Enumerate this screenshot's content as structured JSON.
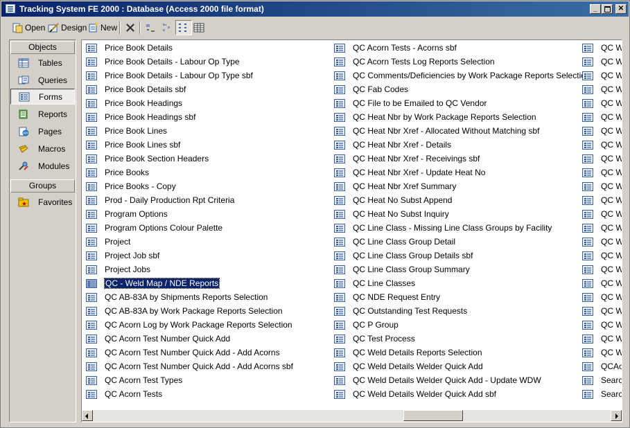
{
  "window": {
    "title": "Tracking System FE 2000 : Database (Access 2000 file format)"
  },
  "toolbar": {
    "open_label": "Open",
    "design_label": "Design",
    "new_label": "New"
  },
  "sidebar": {
    "objects_header": "Objects",
    "groups_header": "Groups",
    "items": [
      {
        "label": "Tables",
        "icon": "table-icon"
      },
      {
        "label": "Queries",
        "icon": "query-icon"
      },
      {
        "label": "Forms",
        "icon": "form-icon",
        "selected": true
      },
      {
        "label": "Reports",
        "icon": "report-icon"
      },
      {
        "label": "Pages",
        "icon": "page-icon"
      },
      {
        "label": "Macros",
        "icon": "macro-icon"
      },
      {
        "label": "Modules",
        "icon": "module-icon"
      }
    ],
    "groups": [
      {
        "label": "Favorites",
        "icon": "favorites-icon"
      }
    ]
  },
  "forms": {
    "columns": [
      [
        "Price Book Details",
        "Price Book Details - Labour Op Type",
        "Price Book Details - Labour Op Type sbf",
        "Price Book Details sbf",
        "Price Book Headings",
        "Price Book Headings sbf",
        "Price Book Lines",
        "Price Book Lines sbf",
        "Price Book Section Headers",
        "Price Books",
        "Price Books - Copy",
        "Prod -  Daily Production Rpt Criteria",
        "Program Options",
        "Program Options Colour Palette",
        "Project",
        "Project Job sbf",
        "Project Jobs",
        "QC - Weld Map / NDE Reports",
        "QC AB-83A by Shipments Reports Selection",
        "QC AB-83A by Work Package Reports Selection",
        "QC Acorn Log by Work Package Reports Selection",
        "QC Acorn Test Number Quick Add",
        "QC Acorn Test Number Quick Add - Add Acorns",
        "QC Acorn Test Number Quick Add - Add Acorns sbf",
        "QC Acorn Test Types",
        "QC Acorn Tests"
      ],
      [
        "QC Acorn Tests - Acorns sbf",
        "QC Acorn Tests Log Reports Selection",
        "QC Comments/Deficiencies by Work Package Reports Selection",
        "QC Fab Codes",
        "QC File to be Emailed to QC Vendor",
        "QC Heat Nbr by Work Package Reports Selection",
        "QC Heat Nbr Xref - Allocated Without Matching sbf",
        "QC Heat Nbr Xref - Details",
        "QC Heat Nbr Xref - Receivings sbf",
        "QC Heat Nbr Xref - Update Heat No",
        "QC Heat Nbr Xref Summary",
        "QC Heat No Subst Append",
        "QC Heat No Subst Inquiry",
        "QC Line Class - Missing Line Class Groups by Facility",
        "QC Line Class Group Detail",
        "QC Line Class Group Details sbf",
        "QC Line Class Group Summary",
        "QC Line Classes",
        "QC NDE Request Entry",
        "QC Outstanding Test Requests",
        "QC P Group",
        "QC Test Process",
        "QC Weld Details Reports Selection",
        "QC Weld Details Welder Quick Add",
        "QC Weld Details Welder Quick Add - Update WDW",
        "QC Weld Details Welder Quick Add sbf"
      ],
      [
        "QC W",
        "QC W",
        "QC W",
        "QC W",
        "QC W",
        "QC W",
        "QC W",
        "QC W",
        "QC W",
        "QC W",
        "QC W",
        "QC W",
        "QC W",
        "QC W",
        "QC W",
        "QC W",
        "QC W",
        "QC W",
        "QC W",
        "QC W",
        "QC W",
        "QC W",
        "QC W",
        "QCAc",
        "Searc",
        "Searc"
      ]
    ],
    "selected": "QC - Weld Map / NDE Reports"
  },
  "scrollbar": {
    "thumb_fraction_start": 0.6,
    "thumb_fraction_size": 0.115
  }
}
